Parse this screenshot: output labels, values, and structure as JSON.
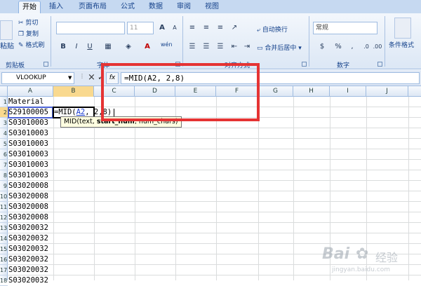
{
  "tabs": [
    "开始",
    "插入",
    "页面布局",
    "公式",
    "数据",
    "审阅",
    "视图"
  ],
  "ribbon": {
    "clipboard": {
      "paste": "粘贴",
      "cut": "剪切",
      "copy": "复制",
      "format_painter": "格式刷",
      "label": "剪贴板"
    },
    "font": {
      "size": "11",
      "grow": "A",
      "shrink": "A",
      "bold": "B",
      "italic": "I",
      "underline": "U",
      "color_a": "A",
      "wen": "wén"
    },
    "alignment": {
      "wrap": "自动换行",
      "merge": "合并后居中",
      "label": "对齐方式"
    },
    "number": {
      "format": "常规",
      "percent": "%",
      "comma": ",",
      "label": "数字"
    },
    "styles": {
      "conditional": "条件格式"
    },
    "font_group_label": "字体"
  },
  "formula_bar": {
    "name_box": "VLOOKUP",
    "cancel": "×",
    "enter": "✓",
    "fx": "fx",
    "formula": "=MID(A2, 2,8)"
  },
  "grid": {
    "columns": [
      "A",
      "B",
      "C",
      "D",
      "E",
      "F",
      "G",
      "H",
      "I",
      "J"
    ],
    "rows": [
      "1",
      "2",
      "3",
      "4",
      "5",
      "6",
      "7",
      "8",
      "9",
      "10",
      "11",
      "12",
      "13",
      "14",
      "15",
      "16",
      "17",
      "18"
    ],
    "col_a_values": [
      "Material",
      "S29100005",
      "S03010003",
      "S03010003",
      "S03010003",
      "S03010003",
      "S03010003",
      "S03010003",
      "S03020008",
      "S03020008",
      "S03020008",
      "S03020008",
      "S03020032",
      "S03020032",
      "S03020032",
      "S03020032",
      "S03020032",
      "S03020032"
    ],
    "edit_prefix": "=MID(",
    "edit_ref": "A2",
    "edit_suffix": ", 2,8)",
    "tooltip_pre": "MID(text, ",
    "tooltip_bold": "start_num",
    "tooltip_post": ", num_chars)"
  },
  "watermark": {
    "brand": "Bai",
    "brand2": "经验",
    "url": "jingyan.baidu.com"
  },
  "colors": {
    "highlight": "#e53333",
    "ribbon": "#dce7f5",
    "ref_blue": "#1f3fd1"
  }
}
